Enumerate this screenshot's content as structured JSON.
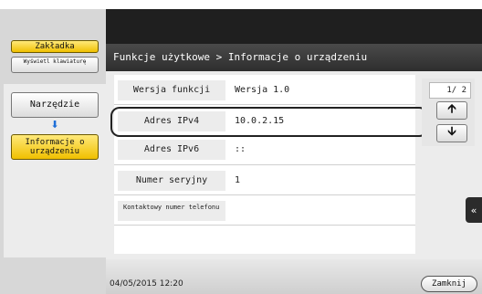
{
  "sidebar": {
    "bookmark_label": "Zakładka",
    "keyboard_label": "Wyświetl klawiaturę",
    "tools_label": "Narzędzie",
    "device_info_label": "Informacje o urządzeniu"
  },
  "header": {
    "title": "Funkcje użytkowe > Informacje o urządzeniu"
  },
  "info_rows": [
    {
      "label": "Wersja funkcji",
      "value": "Wersja 1.0"
    },
    {
      "label": "Adres IPv4",
      "value": "10.0.2.15"
    },
    {
      "label": "Adres IPv6",
      "value": "::"
    },
    {
      "label": "Numer seryjny",
      "value": "1"
    },
    {
      "label": "Kontaktowy numer telefonu",
      "value": ""
    }
  ],
  "pager": {
    "indicator": "1/ 2",
    "up_icon": "arrow-up",
    "down_icon": "arrow-down"
  },
  "footer": {
    "datetime": "04/05/2015  12:20",
    "close_label": "Zamknij"
  },
  "colors": {
    "accent_yellow": "#f0c000",
    "header_dark": "#1f1f1f",
    "arrow_blue": "#1e6fd8"
  }
}
